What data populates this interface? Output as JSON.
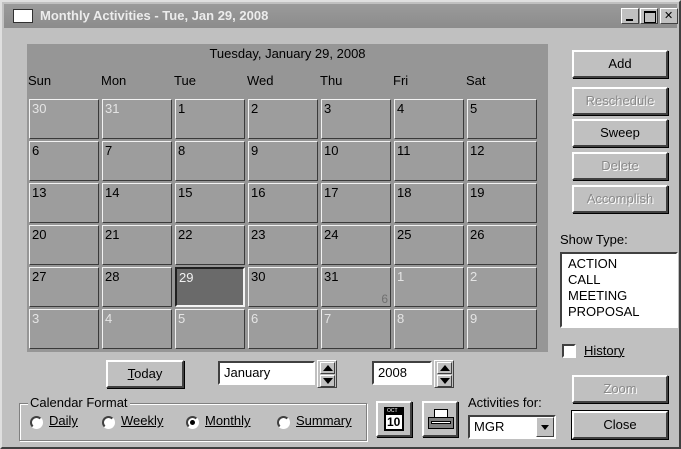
{
  "window": {
    "title": "Monthly Activities - Tue, Jan 29, 2008"
  },
  "calendar": {
    "header": "Tuesday, January 29, 2008",
    "weekdays": [
      "Sun",
      "Mon",
      "Tue",
      "Wed",
      "Thu",
      "Fri",
      "Sat"
    ],
    "weeks": [
      [
        {
          "d": "30",
          "other": true
        },
        {
          "d": "31",
          "other": true
        },
        {
          "d": "1"
        },
        {
          "d": "2"
        },
        {
          "d": "3"
        },
        {
          "d": "4"
        },
        {
          "d": "5"
        }
      ],
      [
        {
          "d": "6"
        },
        {
          "d": "7"
        },
        {
          "d": "8"
        },
        {
          "d": "9"
        },
        {
          "d": "10"
        },
        {
          "d": "11"
        },
        {
          "d": "12"
        }
      ],
      [
        {
          "d": "13"
        },
        {
          "d": "14"
        },
        {
          "d": "15"
        },
        {
          "d": "16"
        },
        {
          "d": "17"
        },
        {
          "d": "18"
        },
        {
          "d": "19"
        }
      ],
      [
        {
          "d": "20"
        },
        {
          "d": "21"
        },
        {
          "d": "22"
        },
        {
          "d": "23"
        },
        {
          "d": "24"
        },
        {
          "d": "25"
        },
        {
          "d": "26"
        }
      ],
      [
        {
          "d": "27"
        },
        {
          "d": "28"
        },
        {
          "d": "29",
          "selected": true
        },
        {
          "d": "30"
        },
        {
          "d": "31",
          "marker": "6"
        },
        {
          "d": "1",
          "other": true
        },
        {
          "d": "2",
          "other": true
        }
      ],
      [
        {
          "d": "3",
          "other": true
        },
        {
          "d": "4",
          "other": true
        },
        {
          "d": "5",
          "other": true
        },
        {
          "d": "6",
          "other": true
        },
        {
          "d": "7",
          "other": true
        },
        {
          "d": "8",
          "other": true
        },
        {
          "d": "9",
          "other": true
        }
      ]
    ]
  },
  "navigation": {
    "today_label": "Today",
    "month_value": "January",
    "year_value": "2008"
  },
  "side_buttons": {
    "add": "Add",
    "reschedule": "Reschedule",
    "sweep": "Sweep",
    "delete": "Delete",
    "accomplish": "Accomplish",
    "zoom": "Zoom",
    "close": "Close"
  },
  "show_type": {
    "label": "Show Type:",
    "items": [
      "ACTION",
      "CALL",
      "MEETING",
      "PROPOSAL"
    ]
  },
  "history": {
    "label": "History",
    "checked": false
  },
  "calendar_format": {
    "title": "Calendar Format",
    "options": [
      "Daily",
      "Weekly",
      "Monthly",
      "Summary"
    ],
    "selected": "Monthly"
  },
  "activities_for": {
    "label": "Activities for:",
    "value": "MGR"
  },
  "icons": {
    "calendar_icon": "calendar-icon",
    "calendar_icon_day": "10",
    "printer_icon": "printer-icon"
  }
}
